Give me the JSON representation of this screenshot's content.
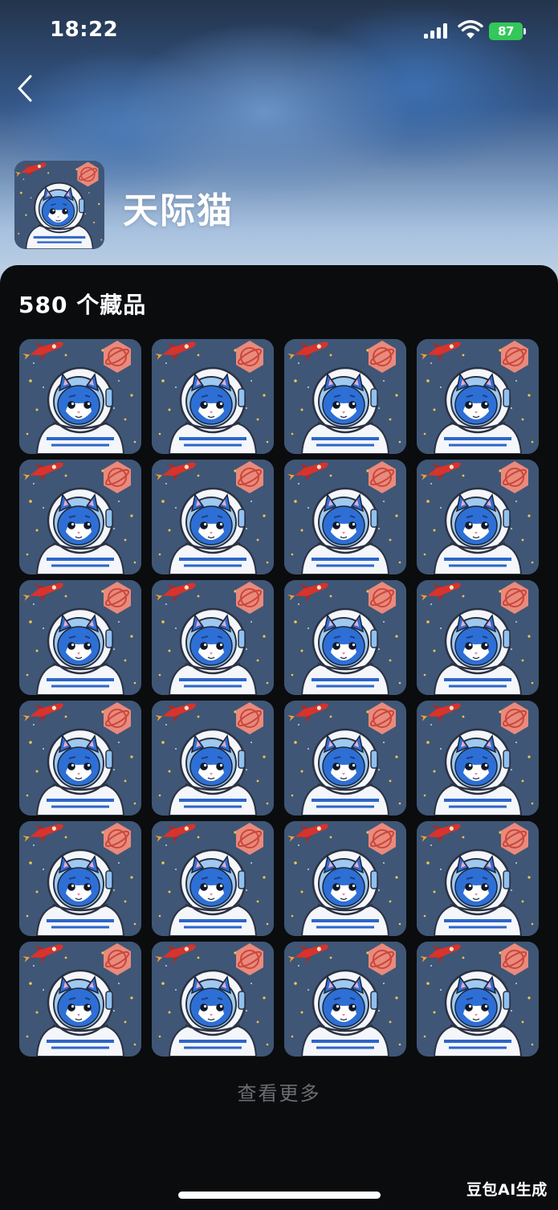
{
  "status_bar": {
    "time": "18:22",
    "battery": "87"
  },
  "collection": {
    "title": "天际猫",
    "count_label": "580 个藏品"
  },
  "grid": {
    "columns": 4,
    "rows": 6,
    "item_icon": "astronaut-cat-nft",
    "item_count_visible": 24
  },
  "actions": {
    "see_more": "查看更多"
  },
  "watermark": "豆包AI生成",
  "colors": {
    "battery": "#34c759",
    "panel_background": "#0b0c0e",
    "card_background": "#3d5474",
    "see_more_text": "#6b6d72"
  }
}
